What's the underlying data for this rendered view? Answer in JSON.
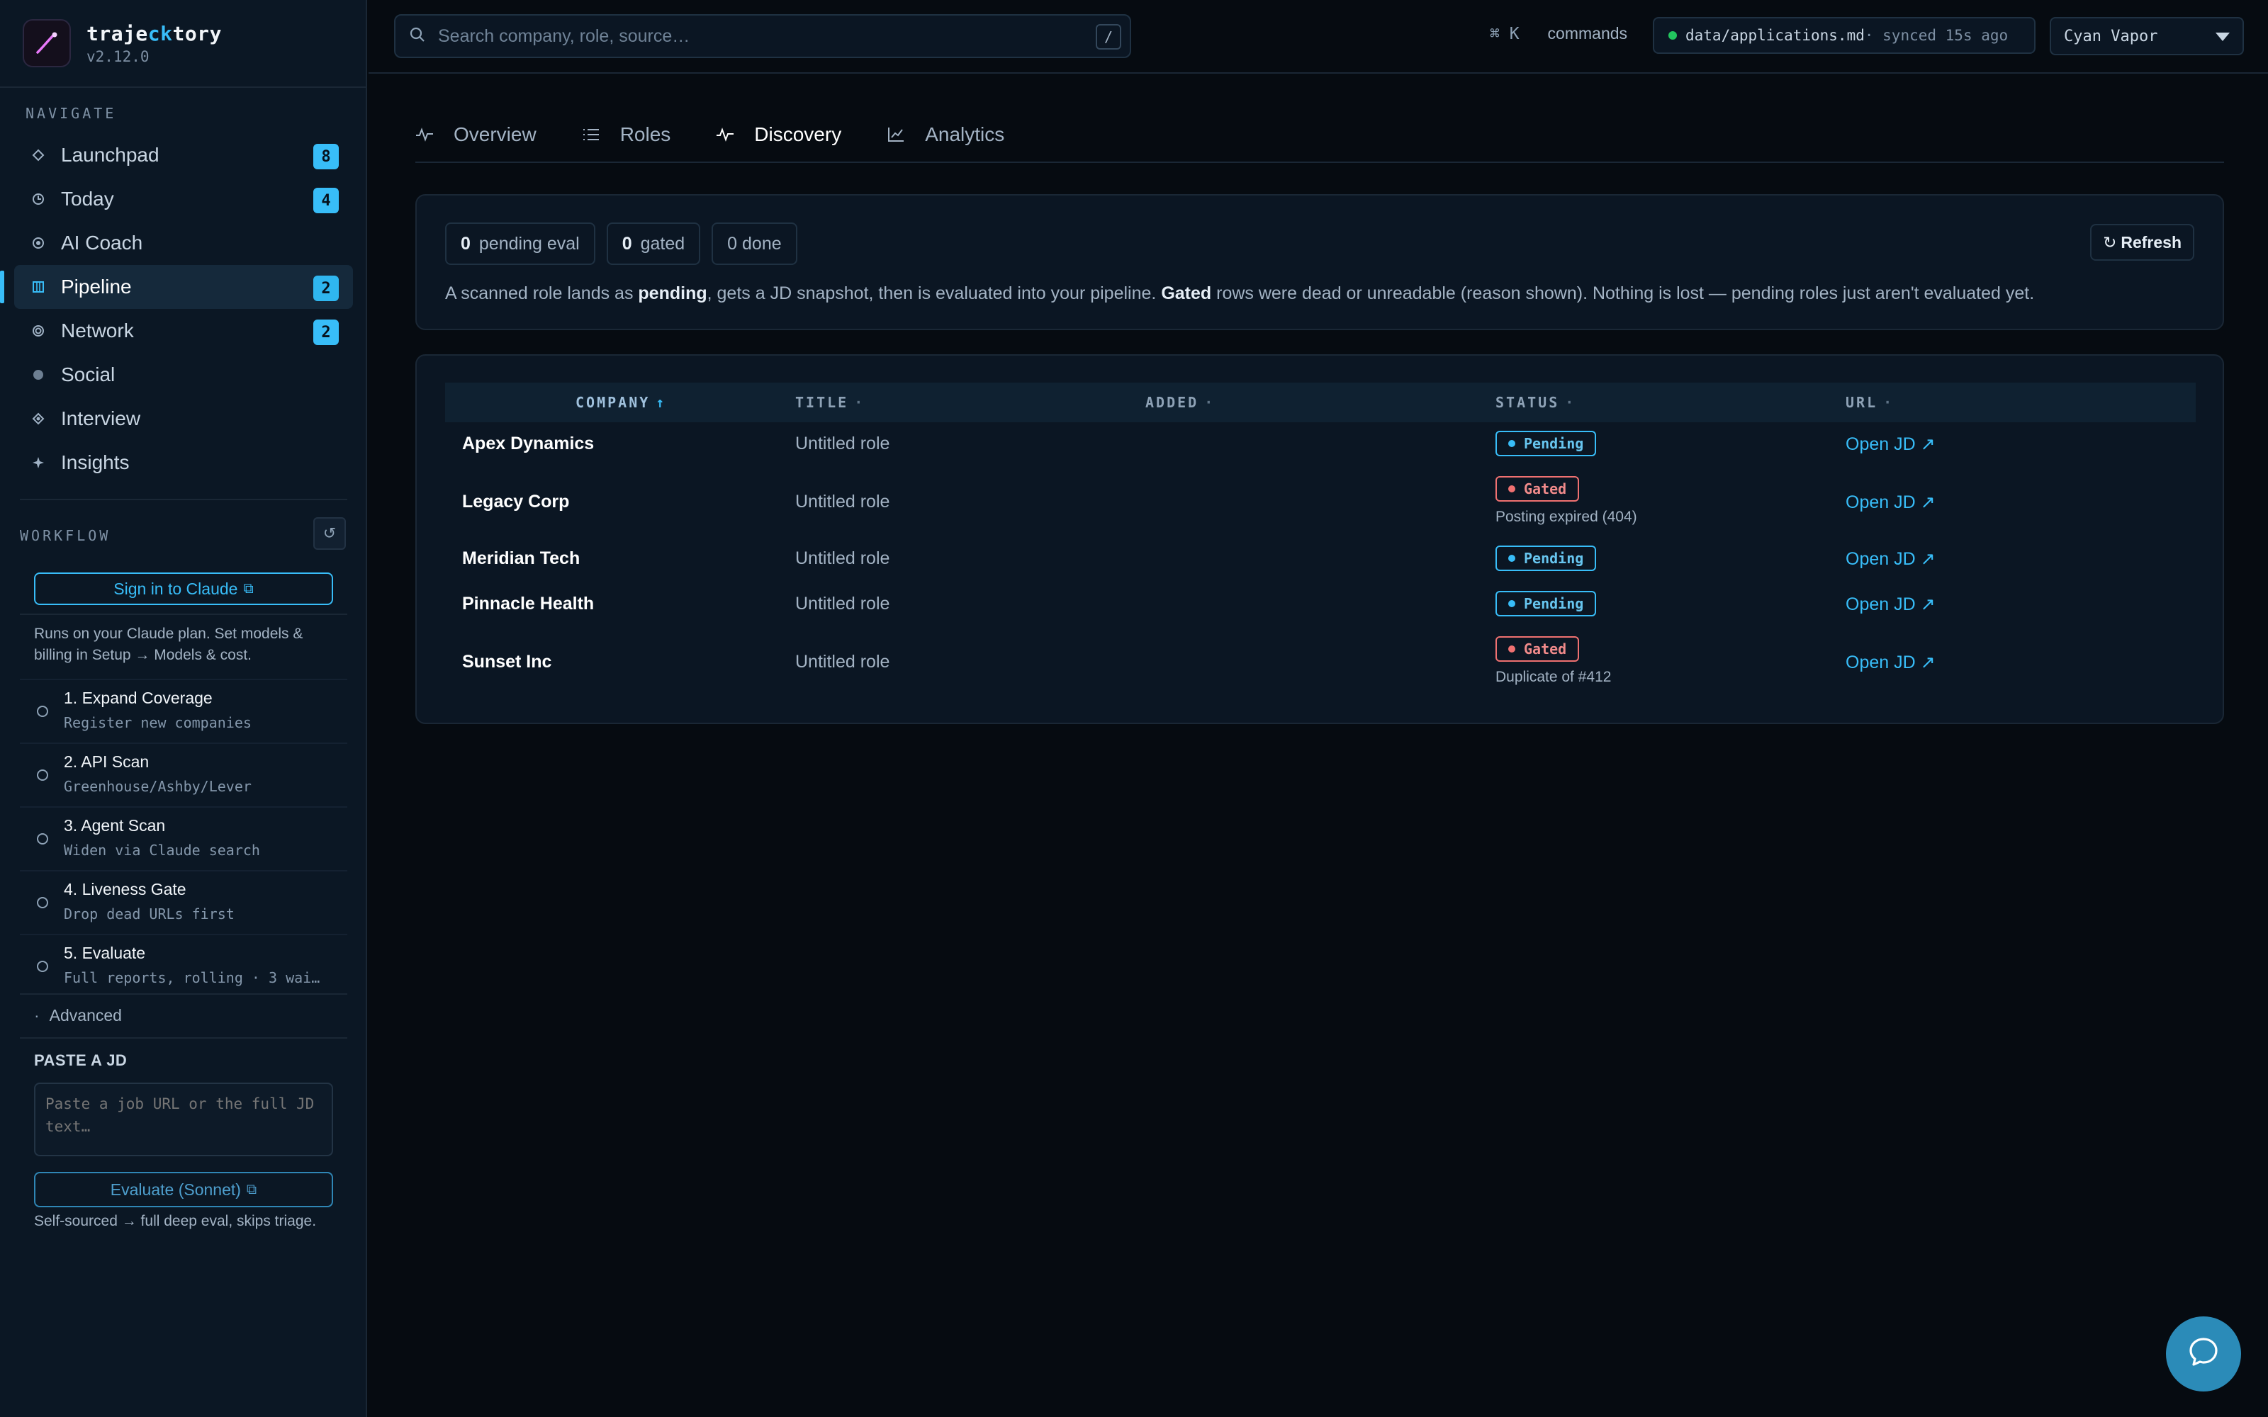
{
  "app": {
    "name_prefix": "traje",
    "name_highlight": "ck",
    "name_suffix": "tory",
    "version": "v2.12.0"
  },
  "navigate_label": "NAVIGATE",
  "nav": [
    {
      "label": "Launchpad",
      "badge": "8",
      "icon": "diamond-icon"
    },
    {
      "label": "Today",
      "badge": "4",
      "icon": "clock-icon"
    },
    {
      "label": "AI Coach",
      "badge": "",
      "icon": "target-icon"
    },
    {
      "label": "Pipeline",
      "badge": "2",
      "icon": "grid-icon",
      "active": true
    },
    {
      "label": "Network",
      "badge": "2",
      "icon": "ring-icon"
    },
    {
      "label": "Social",
      "badge": "",
      "icon": "circle-icon"
    },
    {
      "label": "Interview",
      "badge": "",
      "icon": "diamond-dot-icon"
    },
    {
      "label": "Insights",
      "badge": "",
      "icon": "sparkle-icon"
    }
  ],
  "workflow": {
    "label": "WORKFLOW",
    "sign_in": "Sign in to Claude",
    "note": "Runs on your Claude plan. Set models & billing in Setup → Models & cost.",
    "steps": [
      {
        "title": "1. Expand Coverage",
        "sub": "Register new companies"
      },
      {
        "title": "2. API Scan",
        "sub": "Greenhouse/Ashby/Lever"
      },
      {
        "title": "3. Agent Scan",
        "sub": "Widen via Claude search"
      },
      {
        "title": "4. Liveness Gate",
        "sub": "Drop dead URLs first"
      },
      {
        "title": "5. Evaluate",
        "sub": "Full reports, rolling · 3 wai…"
      }
    ],
    "advanced": "Advanced"
  },
  "paste": {
    "label": "PASTE A JD",
    "placeholder": "Paste a job URL or the full JD text…",
    "button": "Evaluate (Sonnet)",
    "note": "Self-sourced → full deep eval, skips triage."
  },
  "topbar": {
    "search_placeholder": "Search company, role, source…",
    "search_key": "/",
    "cmd_key": "⌘ K",
    "cmd_label": "commands",
    "sync_file": "data/applications.md",
    "sync_status": " · synced 15s ago",
    "theme": "Cyan Vapor"
  },
  "tabs": [
    {
      "label": "Overview",
      "icon": "pulse-icon"
    },
    {
      "label": "Roles",
      "icon": "list-icon"
    },
    {
      "label": "Discovery",
      "icon": "activity-icon",
      "active": true
    },
    {
      "label": "Analytics",
      "icon": "chart-icon"
    }
  ],
  "summary": {
    "pending_count": "0",
    "pending_label": "pending eval",
    "gated_count": "0",
    "gated_label": "gated",
    "done_label": "0 done",
    "refresh": "Refresh",
    "desc_1": "A scanned role lands as ",
    "desc_pending": "pending",
    "desc_2": ", gets a JD snapshot, then is evaluated into your pipeline. ",
    "desc_gated": "Gated",
    "desc_3": " rows were dead or unreadable (reason shown). Nothing is lost — pending roles just aren't evaluated yet."
  },
  "table": {
    "headers": {
      "company": "COMPANY",
      "title": "TITLE",
      "added": "ADDED",
      "status": "STATUS",
      "url": "URL"
    },
    "rows": [
      {
        "company": "Apex Dynamics",
        "title": "Untitled role",
        "added": "",
        "status": "Pending",
        "reason": "",
        "url": "Open JD ↗"
      },
      {
        "company": "Legacy Corp",
        "title": "Untitled role",
        "added": "",
        "status": "Gated",
        "reason": "Posting expired (404)",
        "url": "Open JD ↗"
      },
      {
        "company": "Meridian Tech",
        "title": "Untitled role",
        "added": "",
        "status": "Pending",
        "reason": "",
        "url": "Open JD ↗"
      },
      {
        "company": "Pinnacle Health",
        "title": "Untitled role",
        "added": "",
        "status": "Pending",
        "reason": "",
        "url": "Open JD ↗"
      },
      {
        "company": "Sunset Inc",
        "title": "Untitled role",
        "added": "",
        "status": "Gated",
        "reason": "Duplicate of #412",
        "url": "Open JD ↗"
      }
    ]
  },
  "colors": {
    "accent": "#38bdf8",
    "gated": "#f07171",
    "synced": "#22c55e"
  }
}
